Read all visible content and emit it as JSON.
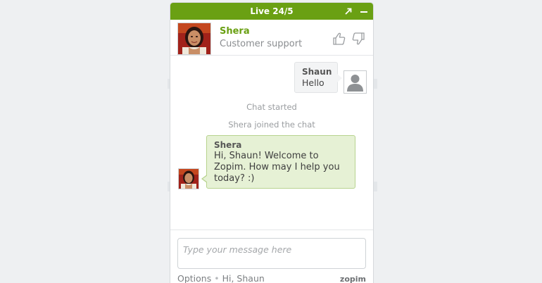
{
  "widget": {
    "title": "Live 24/5",
    "brand_color": "#6aa013",
    "popout_icon": "popout-arrow-icon",
    "minimize_icon": "minimize-icon"
  },
  "agent": {
    "name": "Shera",
    "role": "Customer support",
    "rate_good_icon": "thumbs-up-icon",
    "rate_bad_icon": "thumbs-down-icon"
  },
  "messages": [
    {
      "from": "visitor",
      "name": "Shaun",
      "text": "Hello"
    },
    {
      "from": "system",
      "text": "Chat started"
    },
    {
      "from": "system",
      "text": "Shera joined the chat"
    },
    {
      "from": "agent",
      "name": "Shera",
      "text": "Hi, Shaun! Welcome to Zopim. How may I help you today? :)"
    }
  ],
  "input": {
    "placeholder": "Type your message here",
    "value": ""
  },
  "footer": {
    "options_label": "Options",
    "separator": "•",
    "greeting": "Hi, Shaun",
    "brand": "zopim"
  }
}
